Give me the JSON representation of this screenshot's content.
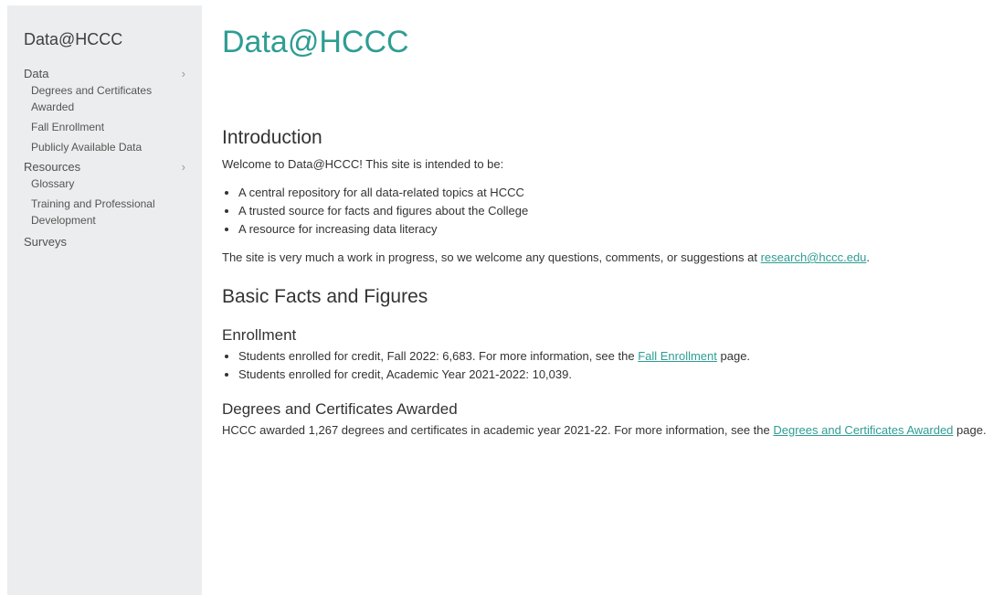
{
  "sidebar": {
    "title": "Data@HCCC",
    "sections": [
      {
        "label": "Data",
        "chevron": "›",
        "items": [
          "Degrees and Certificates Awarded",
          "Fall Enrollment",
          "Publicly Available Data"
        ]
      },
      {
        "label": "Resources",
        "chevron": "›",
        "items": [
          "Glossary",
          "Training and Professional Development"
        ]
      },
      {
        "label": "Surveys",
        "items": []
      }
    ]
  },
  "main": {
    "title": "Data@HCCC",
    "intro": {
      "heading": "Introduction",
      "lead": "Welcome to Data@HCCC! This site is intended to be:",
      "bullets": [
        "A central repository for all data-related topics at HCCC",
        "A trusted source for facts and figures about the College",
        "A resource for increasing data literacy"
      ],
      "note_before": "The site is very much a work in progress, so we welcome any questions, comments, or suggestions at ",
      "note_link": "research@hccc.edu",
      "note_after": "."
    },
    "facts": {
      "heading": "Basic Facts and Figures",
      "enrollment": {
        "heading": "Enrollment",
        "bullet1_before": "Students enrolled for credit, Fall 2022: 6,683. For more information, see the ",
        "bullet1_link": "Fall Enrollment",
        "bullet1_after": " page.",
        "bullet2": "Students enrolled for credit, Academic Year 2021-2022: 10,039."
      },
      "degrees": {
        "heading": "Degrees and Certificates Awarded",
        "text_before": "HCCC awarded 1,267 degrees and certificates in academic year 2021-22. For more information, see the ",
        "text_link": "Degrees and Certificates Awarded",
        "text_after": " page."
      }
    }
  },
  "colors": {
    "accent": "#2e9d93",
    "sidebar_bg": "#ecedee"
  }
}
